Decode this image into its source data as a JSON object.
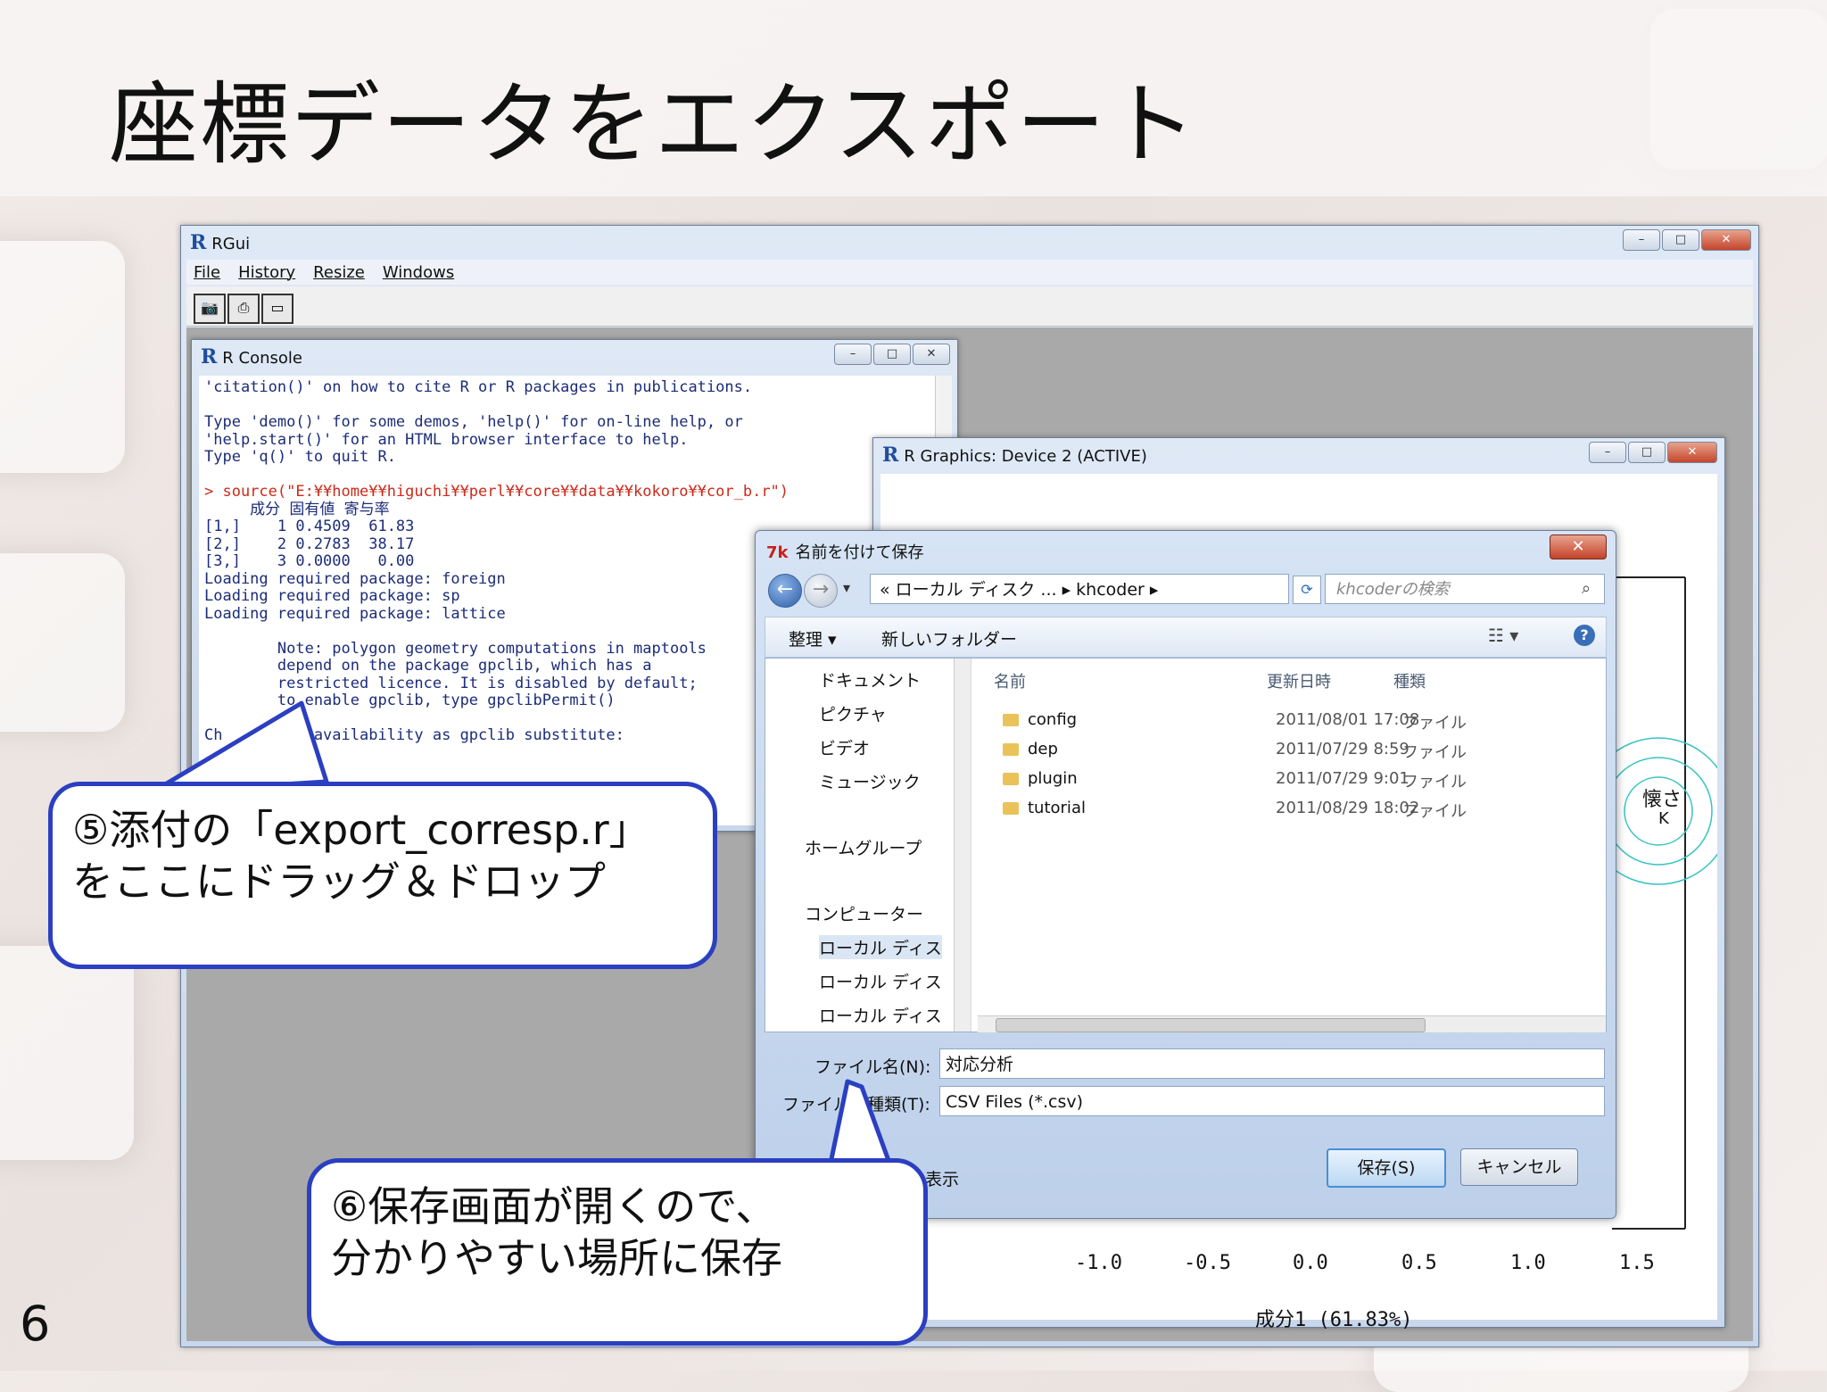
{
  "slide": {
    "title": "座標データをエクスポート",
    "page_number": "6"
  },
  "rgui": {
    "title": "RGui",
    "menu": [
      "File",
      "History",
      "Resize",
      "Windows"
    ],
    "window_buttons": [
      "–",
      "□",
      "✕"
    ]
  },
  "console": {
    "title": "R Console",
    "lines": [
      "'citation()' on how to cite R or R packages in publications.",
      "",
      "Type 'demo()' for some demos, 'help()' for on-line help, or",
      "'help.start()' for an HTML browser interface to help.",
      "Type 'q()' to quit R.",
      "",
      "> source(\"E:¥¥home¥¥higuchi¥¥perl¥¥core¥¥data¥¥kokoro¥¥cor_b.r\")",
      "     成分 固有値 寄与率",
      "[1,]    1 0.4509  61.83",
      "[2,]    2 0.2783  38.17",
      "[3,]    3 0.0000   0.00",
      "Loading required package: foreign",
      "Loading required package: sp",
      "Loading required package: lattice",
      "",
      "        Note: polygon geometry computations in maptools",
      "        depend on the package gpclib, which has a",
      "        restricted licence. It is disabled by default;",
      "        to enable gpclib, type gpclibPermit()",
      "",
      "Ch       os availability as gpclib substitute:"
    ]
  },
  "graphics": {
    "title": "R Graphics: Device 2 (ACTIVE)",
    "x_ticks": [
      "-1.0",
      "-0.5",
      "0.0",
      "0.5",
      "1.0",
      "1.5"
    ],
    "x_label": "成分1 (61.83%)",
    "partial_label": "懐さ",
    "partial_letter": "K"
  },
  "save_dialog": {
    "title": "名前を付けて保存",
    "address": "« ローカル ディスク ... ▸ khcoder ▸",
    "search_placeholder": "khcoderの検索",
    "organize": "整理 ▾",
    "new_folder": "新しいフォルダー",
    "nav_items": [
      "ドキュメント",
      "ピクチャ",
      "ビデオ",
      "ミュージック",
      "ホームグループ",
      "コンピューター",
      "ローカル ディス",
      "ローカル ディス",
      "ローカル ディス"
    ],
    "columns": [
      "名前",
      "更新日時",
      "種類"
    ],
    "files": [
      {
        "name": "config",
        "date": "2011/08/01 17:08",
        "type": "ファイル"
      },
      {
        "name": "dep",
        "date": "2011/07/29 8:59",
        "type": "ファイル"
      },
      {
        "name": "plugin",
        "date": "2011/07/29 9:01",
        "type": "ファイル"
      },
      {
        "name": "tutorial",
        "date": "2011/08/29 18:02",
        "type": "ファイル"
      }
    ],
    "filename_label": "ファイル名(N):",
    "filename_value": "対応分析",
    "filetype_label": "ファイルの種類(T):",
    "filetype_value": "CSV Files (*.csv)",
    "hide_folders": "表示",
    "save_button": "保存(S)",
    "cancel_button": "キャンセル",
    "close": "✕"
  },
  "callouts": {
    "c5_line1": "⑤添付の「export_corresp.r」",
    "c5_line2": "をここにドラッグ＆ドロップ",
    "c6_line1": "⑥保存画面が開くので、",
    "c6_line2": "分かりやすい場所に保存"
  }
}
